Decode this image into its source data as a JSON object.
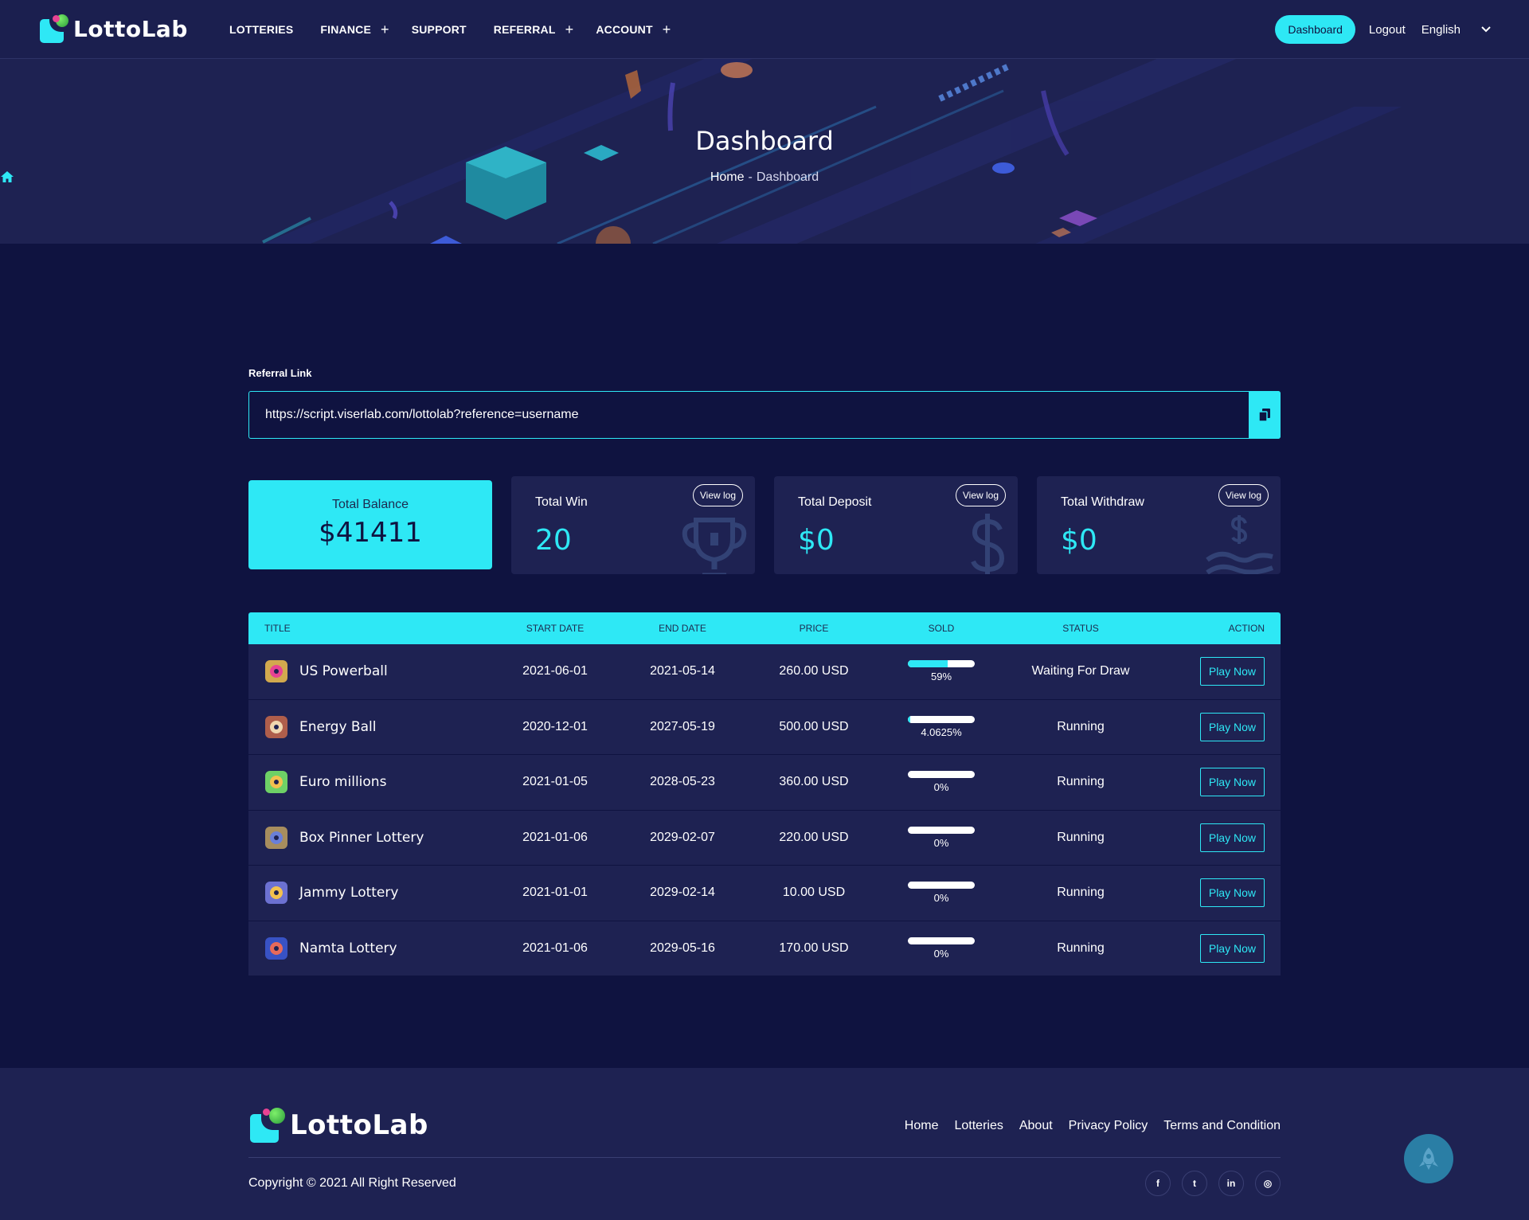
{
  "brand": {
    "name": "LottoLab"
  },
  "nav": {
    "items": [
      {
        "label": "LOTTERIES",
        "plus": false
      },
      {
        "label": "FINANCE",
        "plus": true
      },
      {
        "label": "SUPPORT",
        "plus": false
      },
      {
        "label": "REFERRAL",
        "plus": true
      },
      {
        "label": "ACCOUNT",
        "plus": true
      }
    ],
    "plus_glyph": "+",
    "dashboard_label": "Dashboard",
    "logout_label": "Logout",
    "language": "English"
  },
  "banner": {
    "title": "Dashboard",
    "breadcrumb_home": "Home",
    "breadcrumb_sep": "-",
    "breadcrumb_current": "Dashboard"
  },
  "referral": {
    "label": "Referral Link",
    "value": "https://script.viserlab.com/lottolab?reference=username"
  },
  "stats": {
    "balance": {
      "label": "Total Balance",
      "value": "$41411"
    },
    "win": {
      "label": "Total Win",
      "value": "20",
      "button": "View log"
    },
    "deposit": {
      "label": "Total Deposit",
      "value": "$0",
      "button": "View log"
    },
    "withdraw": {
      "label": "Total Withdraw",
      "value": "$0",
      "button": "View log"
    }
  },
  "table": {
    "headers": {
      "title": "TITLE",
      "start": "START DATE",
      "end": "END DATE",
      "price": "PRICE",
      "sold": "SOLD",
      "status": "STATUS",
      "action": "ACTION"
    },
    "rows": [
      {
        "title": "US Powerball",
        "icon": "powerball-icon",
        "start": "2021-06-01",
        "end": "2021-05-14",
        "price": "260.00 USD",
        "sold_label": "59%",
        "sold_fraction": 0.59,
        "status": "Waiting For Draw",
        "action": "Play Now"
      },
      {
        "title": "Energy Ball",
        "icon": "energy-ball-icon",
        "start": "2020-12-01",
        "end": "2027-05-19",
        "price": "500.00 USD",
        "sold_label": "4.0625%",
        "sold_fraction": 0.040625,
        "status": "Running",
        "action": "Play Now"
      },
      {
        "title": "Euro millions",
        "icon": "euro-millions-icon",
        "start": "2021-01-05",
        "end": "2028-05-23",
        "price": "360.00 USD",
        "sold_label": "0%",
        "sold_fraction": 0,
        "status": "Running",
        "action": "Play Now"
      },
      {
        "title": "Box Pinner Lottery",
        "icon": "box-pinner-icon",
        "start": "2021-01-06",
        "end": "2029-02-07",
        "price": "220.00 USD",
        "sold_label": "0%",
        "sold_fraction": 0,
        "status": "Running",
        "action": "Play Now"
      },
      {
        "title": "Jammy Lottery",
        "icon": "jammy-lottery-icon",
        "start": "2021-01-01",
        "end": "2029-02-14",
        "price": "10.00 USD",
        "sold_label": "0%",
        "sold_fraction": 0,
        "status": "Running",
        "action": "Play Now"
      },
      {
        "title": "Namta Lottery",
        "icon": "namta-lottery-icon",
        "start": "2021-01-06",
        "end": "2029-05-16",
        "price": "170.00 USD",
        "sold_label": "0%",
        "sold_fraction": 0,
        "status": "Running",
        "action": "Play Now"
      }
    ]
  },
  "footer": {
    "links": [
      "Home",
      "Lotteries",
      "About",
      "Privacy Policy",
      "Terms and Condition"
    ],
    "copyright": "Copyright © 2021 All Right Reserved",
    "socials": [
      {
        "icon": "facebook-icon",
        "glyph": "f"
      },
      {
        "icon": "twitter-icon",
        "glyph": "t"
      },
      {
        "icon": "linkedin-icon",
        "glyph": "in"
      },
      {
        "icon": "instagram-icon",
        "glyph": "◎"
      }
    ]
  },
  "colors": {
    "accent": "#2ee8f5",
    "background": "#0f1340",
    "panel": "#1e2252",
    "header": "#1b1f4f"
  }
}
